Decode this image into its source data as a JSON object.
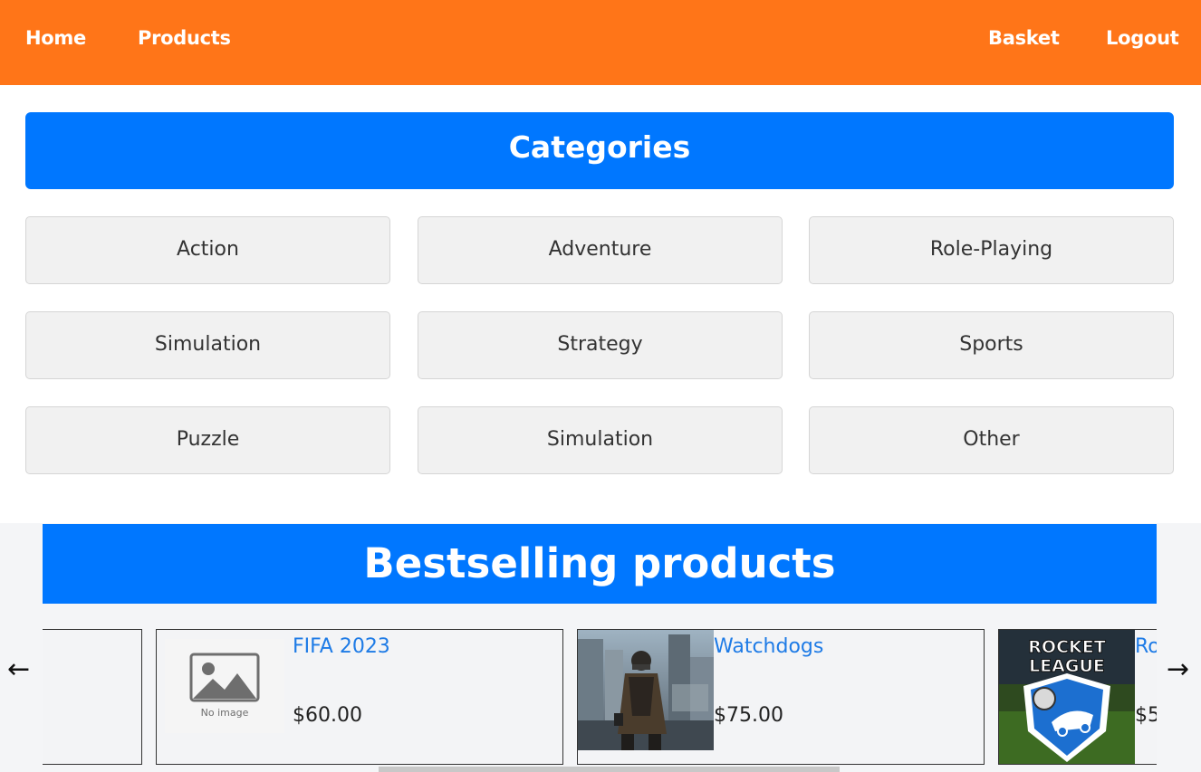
{
  "nav": {
    "home": "Home",
    "products": "Products",
    "basket": "Basket",
    "logout": "Logout",
    "bg_color": "#ff7518"
  },
  "categories": {
    "title": "Categories",
    "items": [
      "Action",
      "Adventure",
      "Role-Playing",
      "Simulation",
      "Strategy",
      "Sports",
      "Puzzle",
      "Simulation",
      "Other"
    ]
  },
  "bestselling": {
    "title": "Bestselling products",
    "prev": "←",
    "next": "→",
    "products": [
      {
        "title": "FIFA 2023",
        "price": "$60.00",
        "image": "No image"
      },
      {
        "title": "Watchdogs",
        "price": "$75.00",
        "image": "watchdogs-cover"
      },
      {
        "title": "Ro",
        "price": "$5",
        "image": "ROCKET LEAGUE"
      }
    ]
  },
  "colors": {
    "accent_blue": "#0077ff",
    "link_blue": "#1e7be6"
  }
}
